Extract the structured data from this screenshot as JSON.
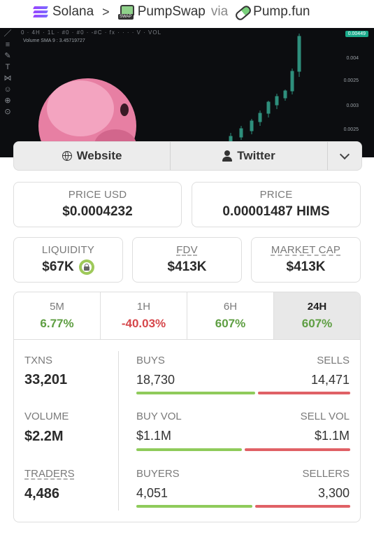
{
  "breadcrumb": {
    "chain": "Solana",
    "separator": ">",
    "dex": "PumpSwap",
    "via": "via",
    "launchpad": "Pump.fun",
    "dex_icon_tag": "SWAP"
  },
  "chart": {
    "topbar_text": "0 · 4H · 1L · #0 · #0 · -#C · fx ·     ·  ·  ·  V ·  VOL",
    "volume_label": "Volume  SMA 9 : 3.45719727",
    "price_tag": "0.00449",
    "yticks": [
      "0.004",
      "0.0025",
      "0.003",
      "0.0025"
    ],
    "tool_icons": [
      "／",
      "≡",
      "✎",
      "T",
      "⋈",
      "☺",
      "⊕",
      "⊙"
    ]
  },
  "links": {
    "website": "Website",
    "twitter": "Twitter"
  },
  "price": {
    "usd_label": "PRICE USD",
    "usd_value": "$0.0004232",
    "native_label": "PRICE",
    "native_value": "0.00001487 HIMS"
  },
  "metrics": {
    "liquidity_label": "LIQUIDITY",
    "liquidity_value": "$67K",
    "fdv_label": "FDV",
    "fdv_value": "$413K",
    "mcap_label": "MARKET CAP",
    "mcap_value": "$413K"
  },
  "timeframes": [
    {
      "label": "5M",
      "change": "6.77%",
      "trend": "up"
    },
    {
      "label": "1H",
      "change": "-40.03%",
      "trend": "down"
    },
    {
      "label": "6H",
      "change": "607%",
      "trend": "up"
    },
    {
      "label": "24H",
      "change": "607%",
      "trend": "up",
      "active": true
    }
  ],
  "stats": {
    "txns_label": "TXNS",
    "txns": "33,201",
    "volume_label": "VOLUME",
    "volume": "$2.2M",
    "traders_label": "TRADERS",
    "traders": "4,486",
    "buys_label": "BUYS",
    "buys": "18,730",
    "sells_label": "SELLS",
    "sells": "14,471",
    "buys_ratio": 0.564,
    "buyvol_label": "BUY VOL",
    "buyvol": "$1.1M",
    "sellvol_label": "SELL VOL",
    "sellvol": "$1.1M",
    "buyvol_ratio": 0.5,
    "buyers_label": "BUYERS",
    "buyers": "4,051",
    "sellers_label": "SELLERS",
    "sellers": "3,300",
    "buyers_ratio": 0.551
  },
  "colors": {
    "up": "#5e9e42",
    "down": "#d6474b",
    "buy_bar": "#8fcb5b",
    "sell_bar": "#e06166"
  }
}
